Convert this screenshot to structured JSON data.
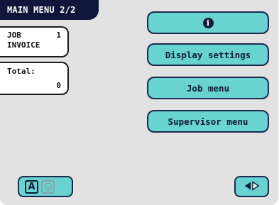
{
  "header": {
    "title": "MAIN MENU 2/2"
  },
  "job": {
    "label": "JOB",
    "number": "1",
    "name": "INVOICE"
  },
  "total": {
    "label": "Total:",
    "value": "0"
  },
  "menu": {
    "info_icon": "info-icon",
    "display_settings": "Display settings",
    "job_menu": "Job menu",
    "supervisor_menu": "Supervisor menu"
  },
  "footer": {
    "mode_letter": "A",
    "shield_icon": "shield-icon",
    "arrows_icon": "left-right-arrows-icon"
  },
  "colors": {
    "background": "#e2e2e2",
    "title_bar": "#10153a",
    "button": "#68d3d0",
    "button_border": "#1a2a50"
  }
}
